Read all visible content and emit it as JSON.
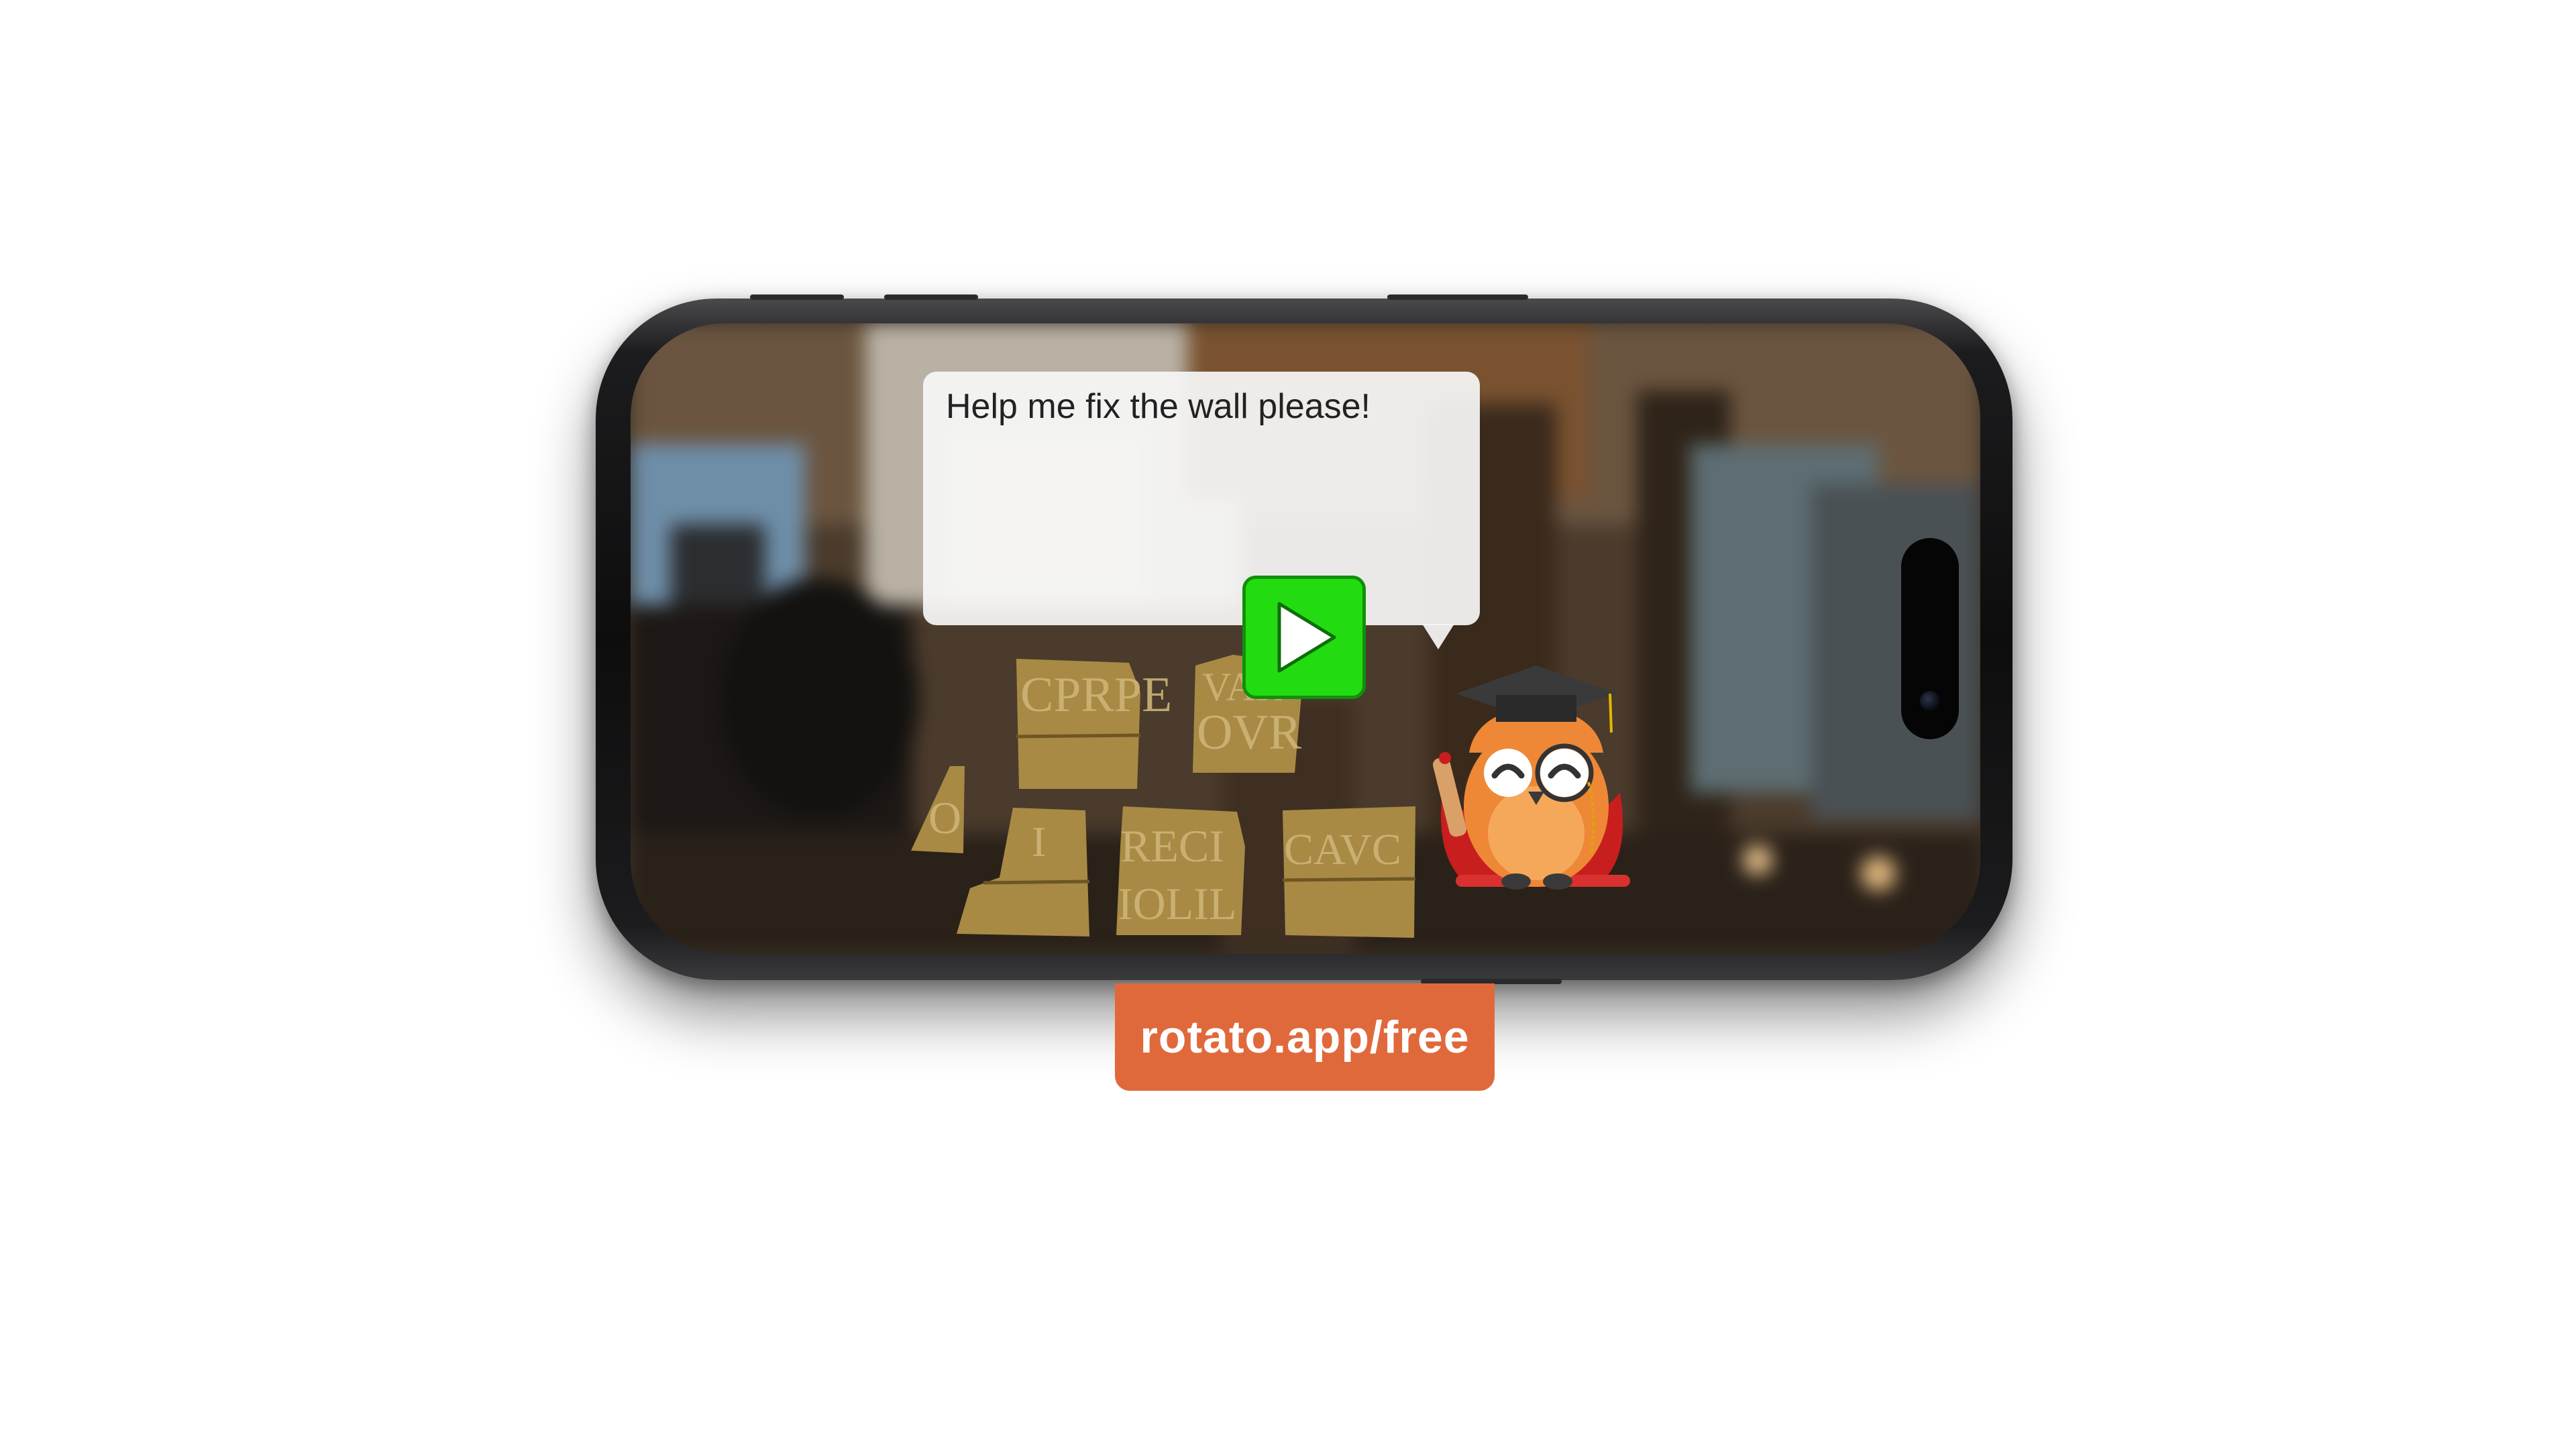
{
  "game": {
    "dialogue": "Help me fix the wall please!",
    "play_icon": "play-icon",
    "character_icon": "owl-professor-icon",
    "fragment_inscriptions": [
      "CPRPE",
      "VAR",
      "OVR",
      "O",
      "RECI",
      "IOLIL",
      "CAVC"
    ]
  },
  "promo": {
    "label": "rotato.app/free",
    "color": "#e0693c"
  },
  "colors": {
    "play_button": "#22dc11",
    "stone": "#a88a45"
  }
}
